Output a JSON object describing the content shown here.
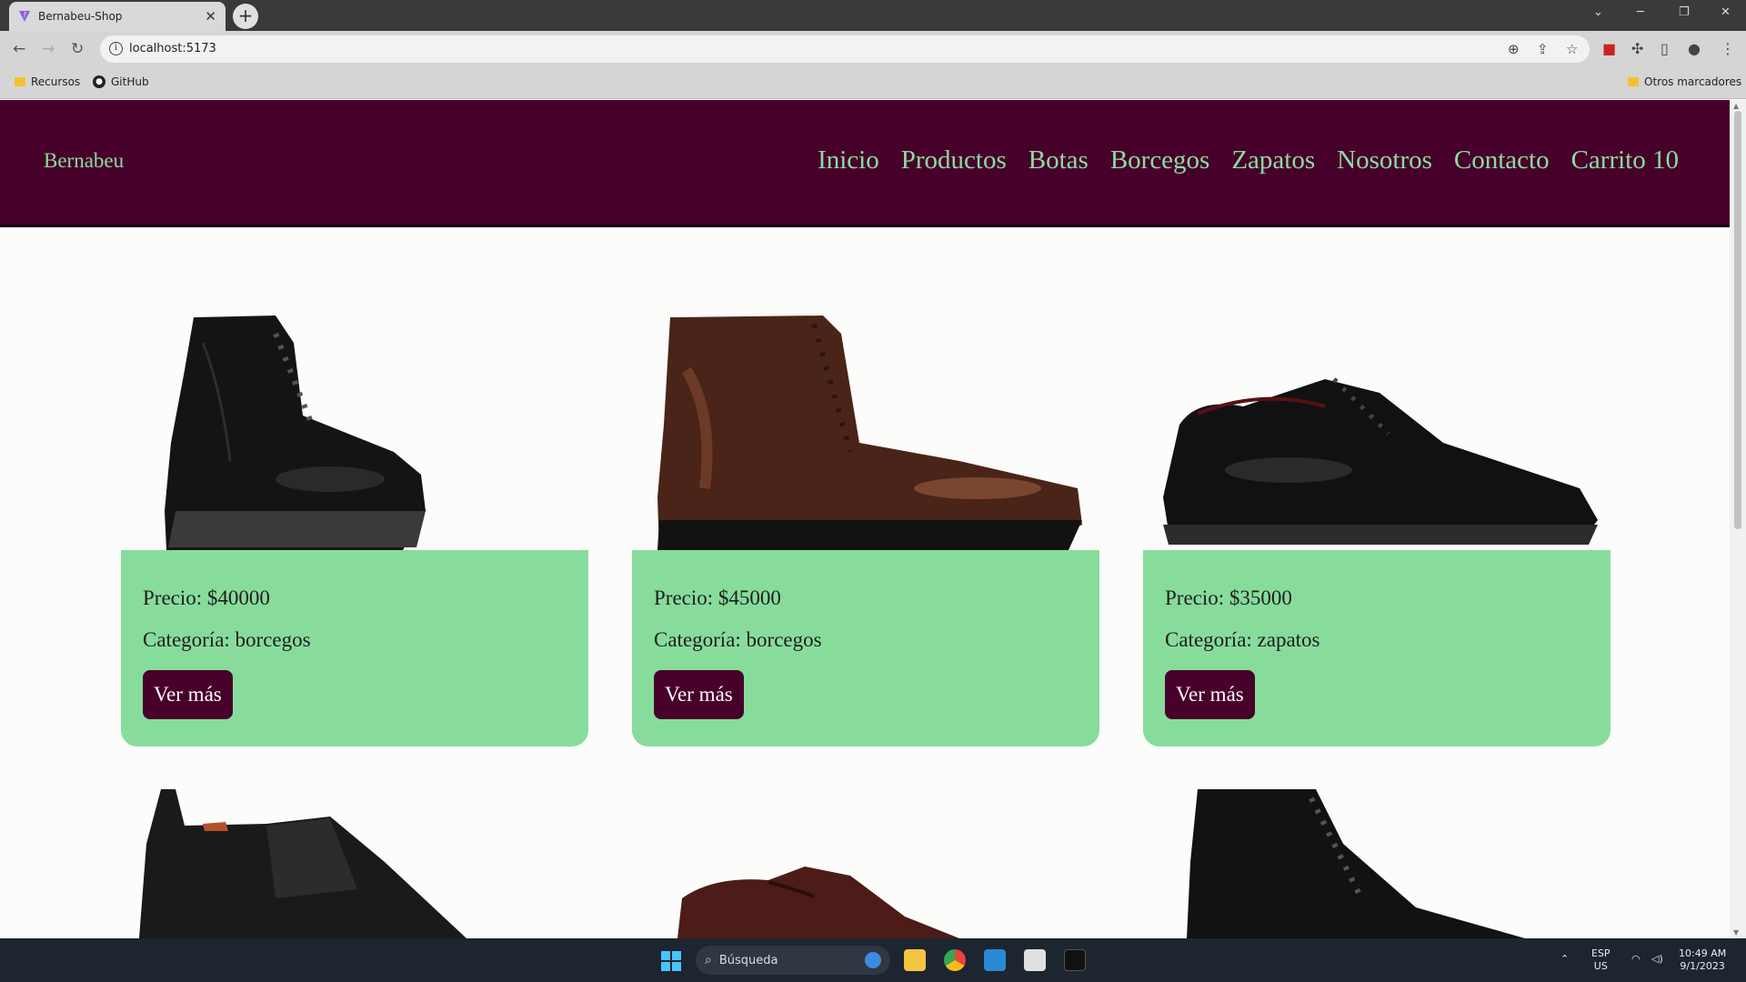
{
  "browser": {
    "tab_title": "Bernabeu-Shop",
    "tab_close": "✕",
    "new_tab": "+",
    "url": "localhost:5173",
    "bookmarks": [
      {
        "label": "Recursos"
      },
      {
        "label": "GitHub"
      }
    ],
    "other_bookmarks": "Otros marcadores"
  },
  "site": {
    "brand": "Bernabeu",
    "nav": [
      "Inicio",
      "Productos",
      "Botas",
      "Borcegos",
      "Zapatos",
      "Nosotros",
      "Contacto",
      "Carrito 10"
    ]
  },
  "products": [
    {
      "price": "Precio: $40000",
      "category": "Categoría: borcegos",
      "button": "Ver más"
    },
    {
      "price": "Precio: $45000",
      "category": "Categoría: borcegos",
      "button": "Ver más"
    },
    {
      "price": "Precio: $35000",
      "category": "Categoría: zapatos",
      "button": "Ver más"
    }
  ],
  "taskbar": {
    "search_placeholder": "Búsqueda",
    "lang_top": "ESP",
    "lang_bottom": "US",
    "time": "10:49 AM",
    "date": "9/1/2023"
  },
  "colors": {
    "header_bg": "#47002a",
    "accent_green": "#87dc9c",
    "nav_text": "#8ddaa3"
  }
}
